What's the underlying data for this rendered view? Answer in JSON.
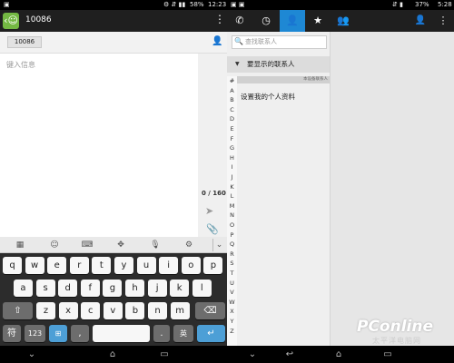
{
  "left": {
    "status": {
      "battery": "58%",
      "time": "12:23"
    },
    "title": "10086",
    "recipient_chip": "10086",
    "compose_placeholder": "键入信息",
    "char_count": "0 / 160",
    "keyboard": {
      "row1": [
        "q",
        "w",
        "e",
        "r",
        "t",
        "y",
        "u",
        "i",
        "o",
        "p"
      ],
      "row2": [
        "a",
        "s",
        "d",
        "f",
        "g",
        "h",
        "j",
        "k",
        "l"
      ],
      "row3": [
        "z",
        "x",
        "c",
        "v",
        "b",
        "n",
        "m"
      ],
      "row4": {
        "sym": "符",
        "num": "123",
        "comma": ",",
        "period": ".",
        "lang": "英"
      }
    }
  },
  "right": {
    "status": {
      "battery": "37%",
      "time": "5:28"
    },
    "search_placeholder": "查找联系人",
    "group_header": "要显示的联系人",
    "owner_tag": "本设备联系人",
    "owner_action": "设置我的个人资料",
    "index_letters": [
      "#",
      "A",
      "B",
      "C",
      "D",
      "E",
      "F",
      "G",
      "H",
      "I",
      "J",
      "K",
      "L",
      "M",
      "N",
      "O",
      "P",
      "Q",
      "R",
      "S",
      "T",
      "U",
      "V",
      "W",
      "X",
      "Y",
      "Z"
    ]
  },
  "watermark": {
    "brand": "PConline",
    "sub": "太平洋电脑网"
  },
  "colors": {
    "accent": "#1e88d4",
    "chip_bg": "#e2e2e2",
    "key_bg": "#f7f7f7"
  }
}
